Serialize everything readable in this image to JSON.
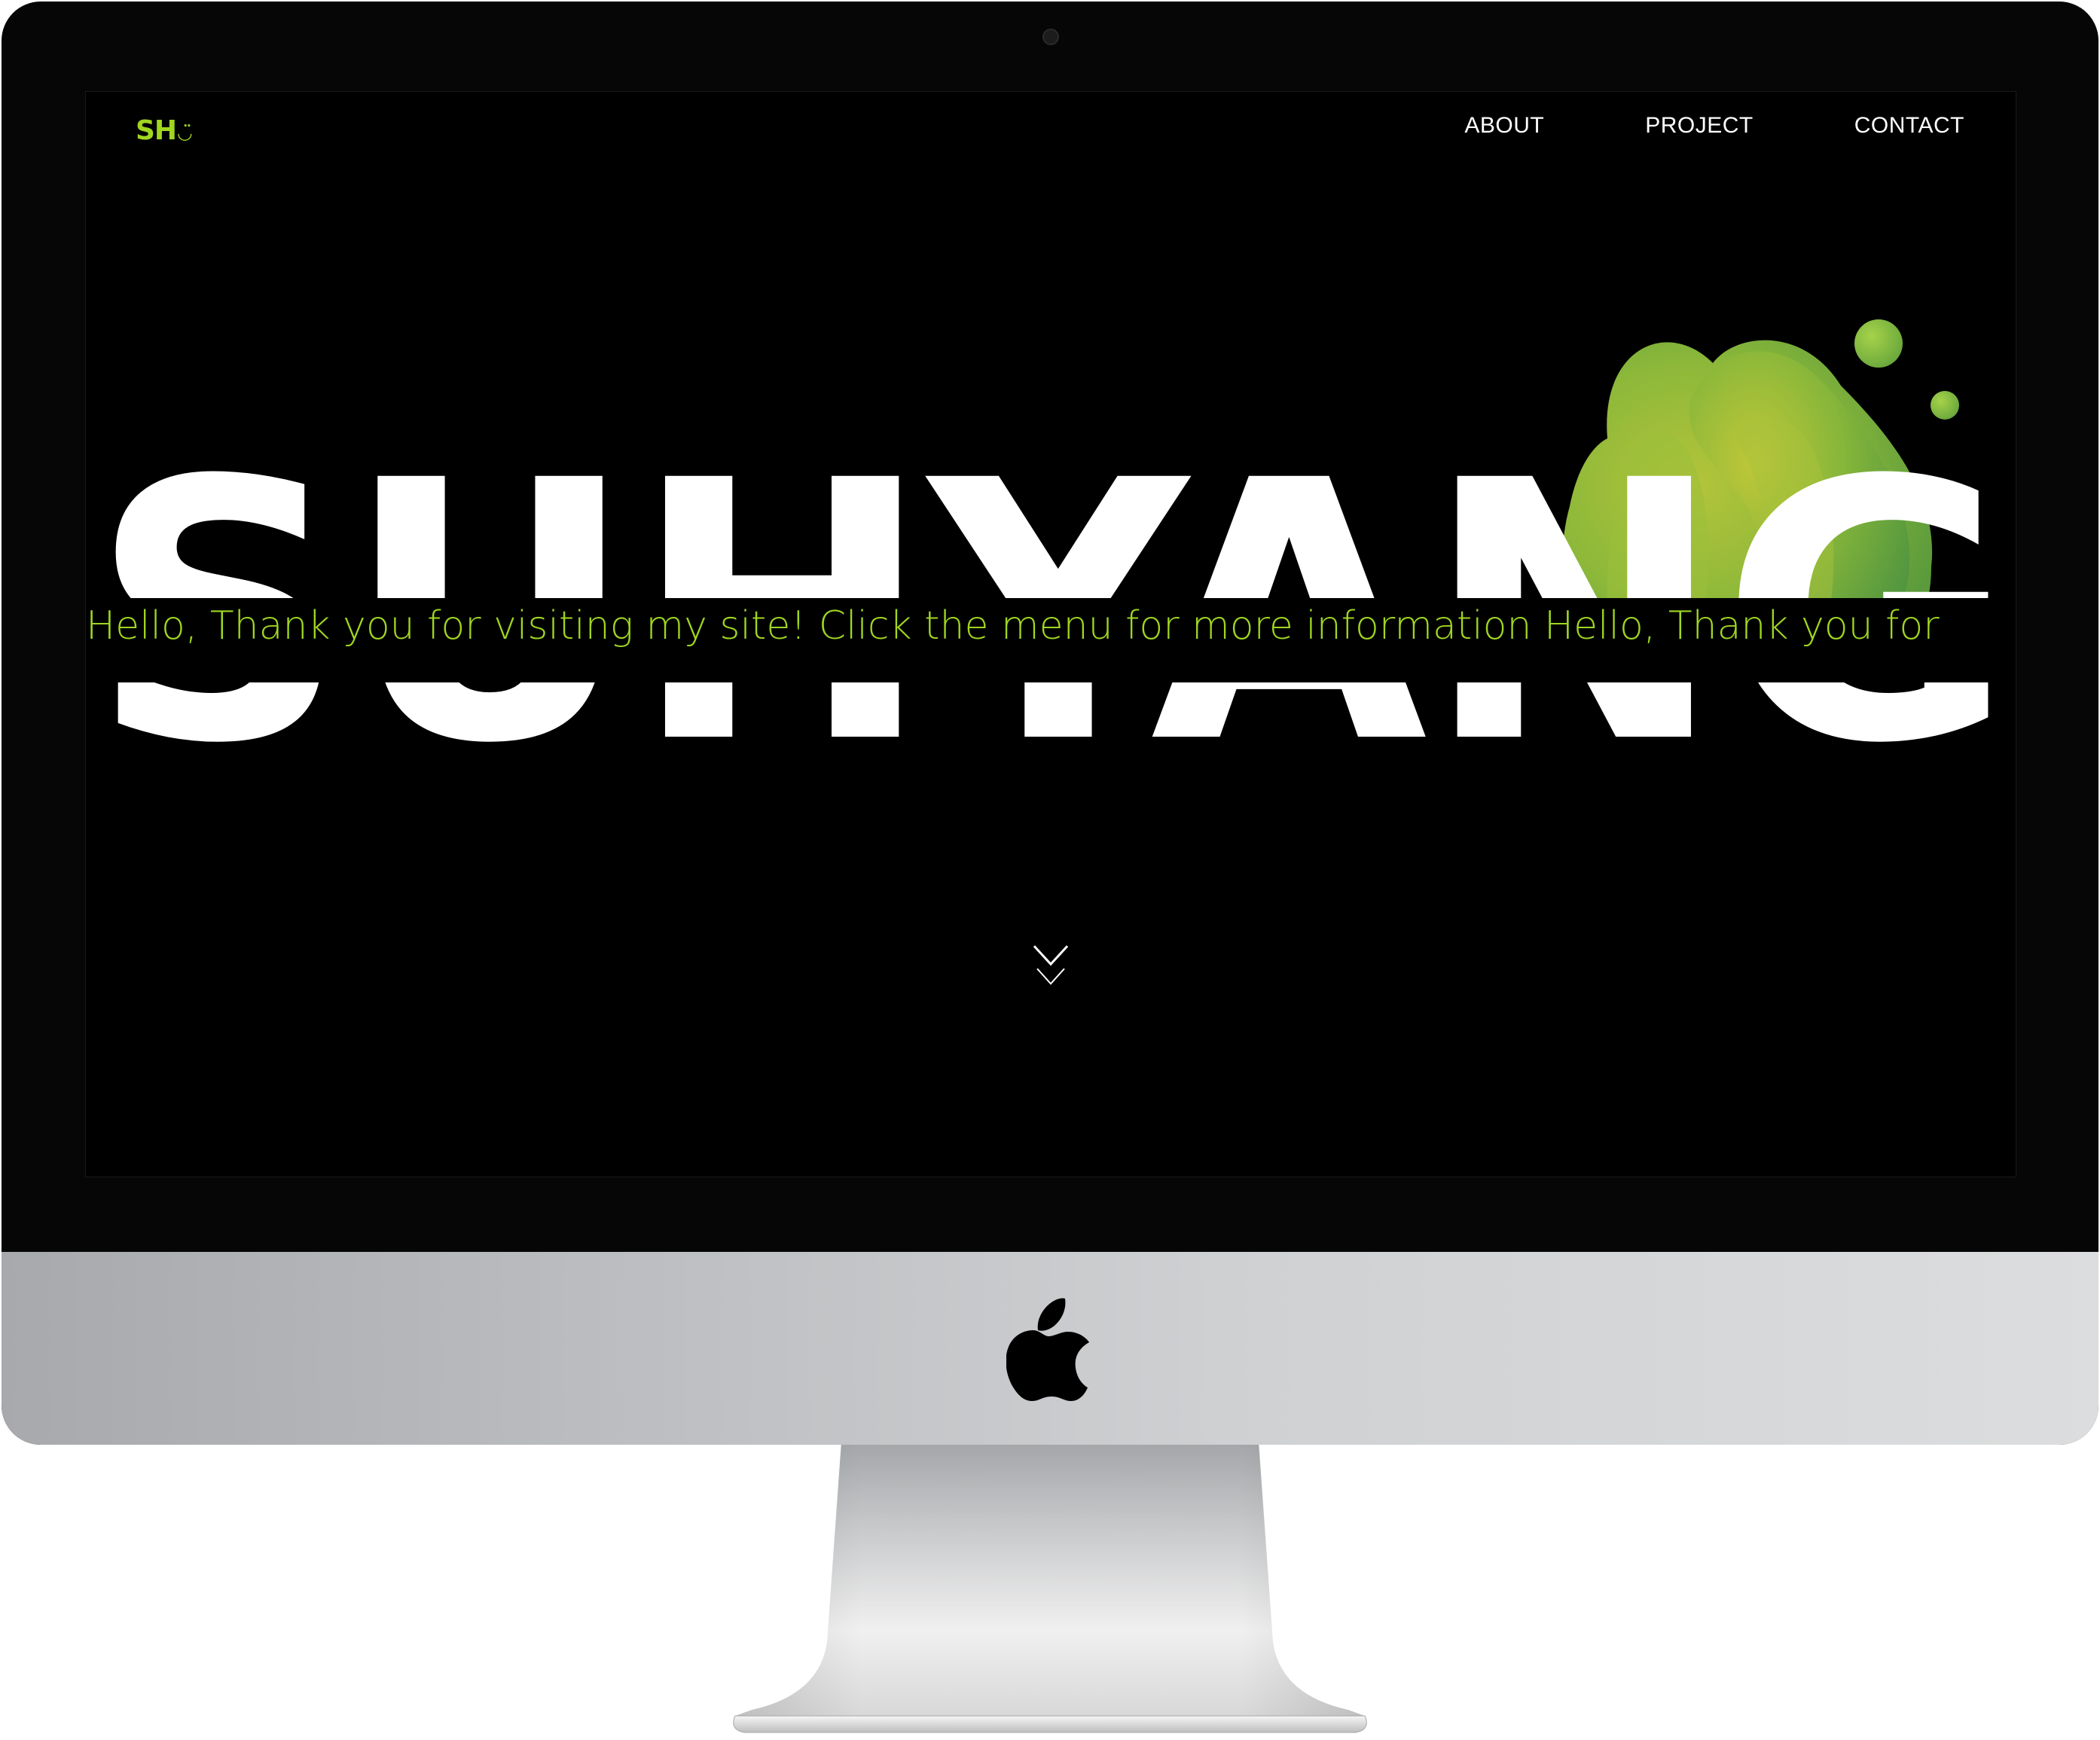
{
  "site": {
    "logo_text": "SH",
    "logo_smile": "◡̈",
    "nav": [
      {
        "label": "ABOUT"
      },
      {
        "label": "PROJECT"
      },
      {
        "label": "CONTACT"
      }
    ],
    "hero_title": "SUHYANG",
    "marquee": "Hello, Thank you for visiting my site! Click the menu for more information Hello, Thank you for",
    "scroll_icon": "double-chevron-down-icon"
  },
  "colors": {
    "accent": "#9fd620",
    "background": "#000000",
    "text": "#ffffff",
    "bezel": "#060606"
  }
}
